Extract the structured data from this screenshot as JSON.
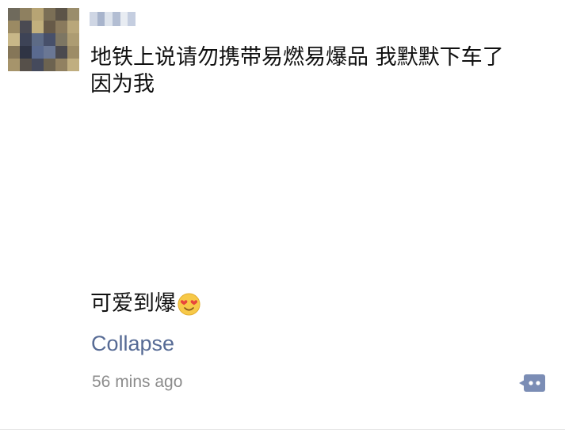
{
  "post": {
    "text": "地铁上说请勿携带易燃易爆品 我默默下车了\n因为我",
    "caption": "可爱到爆",
    "emoji_icon": "heart-eyes-emoji",
    "collapse_label": "Collapse",
    "timestamp": "56 mins ago"
  },
  "icons": {
    "avatar": "pixelated-avatar",
    "username": "blurred-username",
    "comment_button": "comment-bubble-icon"
  },
  "colors": {
    "link": "#576b95",
    "timestamp": "#8c8c8c",
    "comment_button": "#7b8db5"
  }
}
